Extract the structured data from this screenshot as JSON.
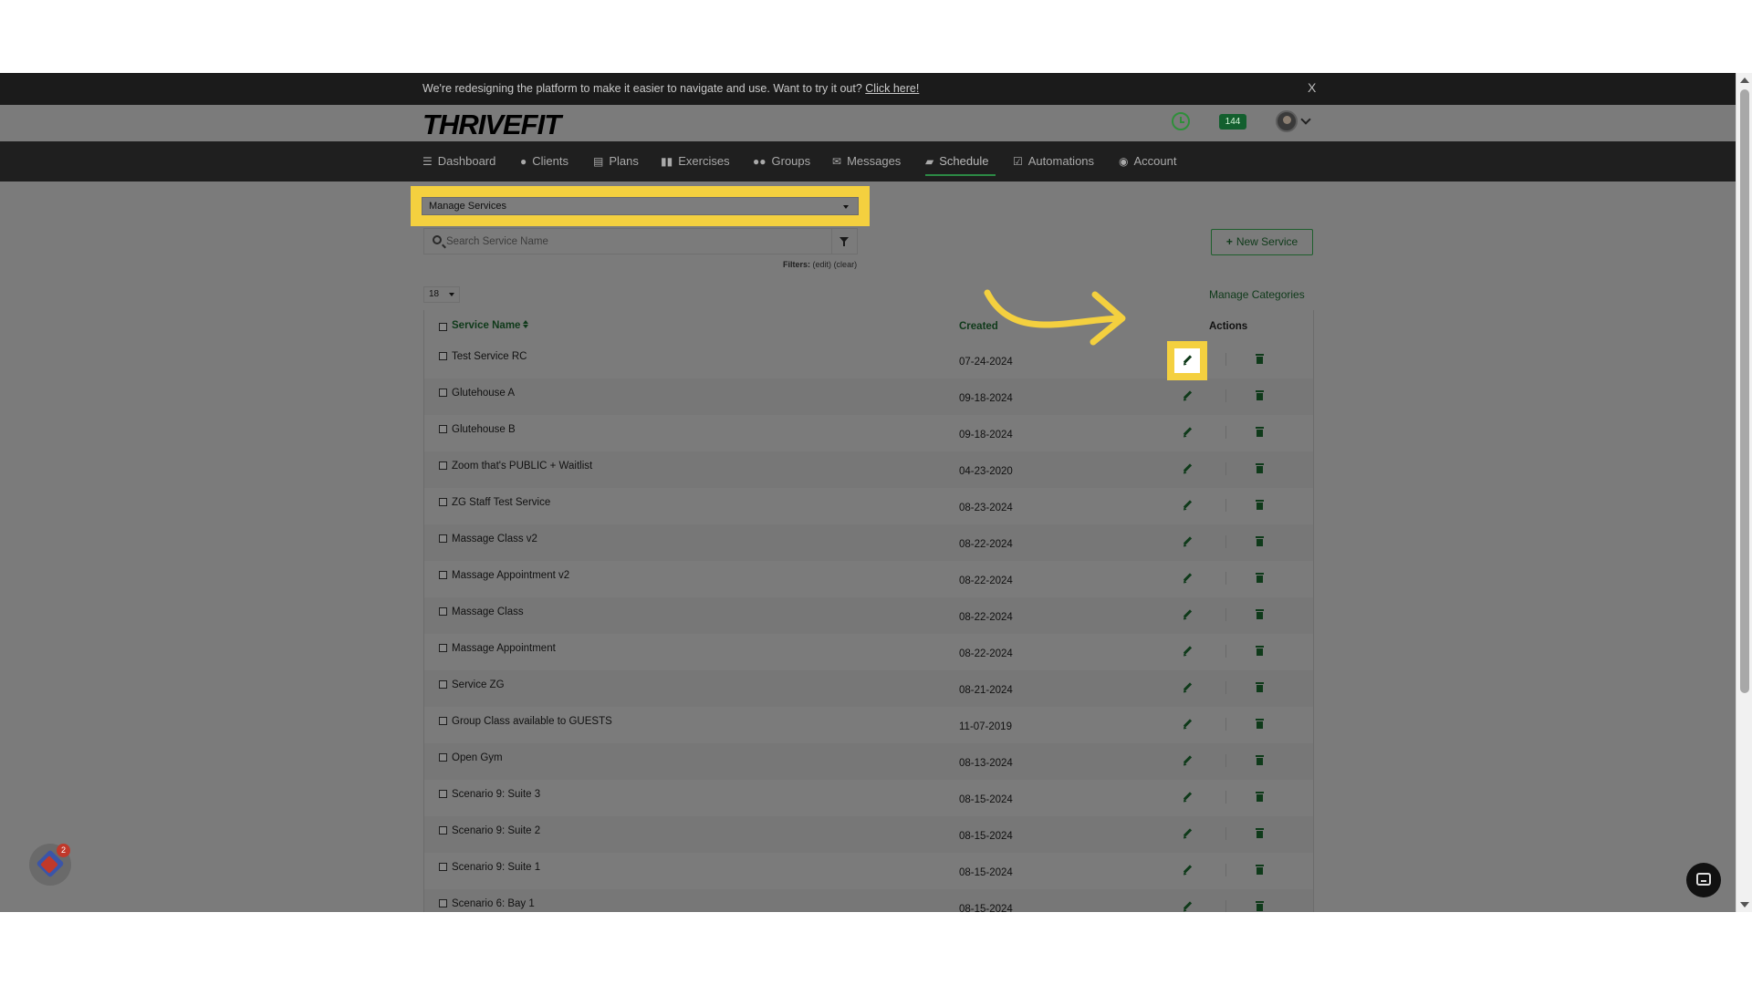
{
  "announcement": {
    "message": "We're redesigning the platform to make it easier to navigate and use. Want to try it out? ",
    "link_text": "Click here!",
    "close_label": "X"
  },
  "brand": {
    "logo": "THRIVEFIT",
    "notification_count": "144"
  },
  "nav": {
    "items": [
      {
        "label": "Dashboard",
        "icon": "list-icon"
      },
      {
        "label": "Clients",
        "icon": "user-icon"
      },
      {
        "label": "Plans",
        "icon": "clipboard-icon"
      },
      {
        "label": "Exercises",
        "icon": "dumbbell-icon"
      },
      {
        "label": "Groups",
        "icon": "users-icon"
      },
      {
        "label": "Messages",
        "icon": "envelope-icon"
      },
      {
        "label": "Schedule",
        "icon": "book-icon",
        "active": true
      },
      {
        "label": "Automations",
        "icon": "check-square-icon"
      },
      {
        "label": "Account",
        "icon": "user-circle-icon"
      }
    ]
  },
  "toolbar": {
    "view_select": "Manage Services",
    "search_placeholder": "Search Service Name",
    "filters_label": "Filters:",
    "filters_edit": "(edit)",
    "filters_clear": "(clear)",
    "new_service_label": "New Service",
    "page_size": "18",
    "manage_categories_label": "Manage Categories"
  },
  "table": {
    "columns": {
      "name": "Service Name",
      "created": "Created",
      "actions": "Actions"
    },
    "rows": [
      {
        "name": "Test Service RC",
        "created": "07-24-2024"
      },
      {
        "name": "Glutehouse A",
        "created": "09-18-2024"
      },
      {
        "name": "Glutehouse B",
        "created": "09-18-2024"
      },
      {
        "name": "Zoom that's PUBLIC + Waitlist",
        "created": "04-23-2020"
      },
      {
        "name": "ZG Staff Test Service",
        "created": "08-23-2024"
      },
      {
        "name": "Massage Class v2",
        "created": "08-22-2024"
      },
      {
        "name": "Massage Appointment v2",
        "created": "08-22-2024"
      },
      {
        "name": "Massage Class",
        "created": "08-22-2024"
      },
      {
        "name": "Massage Appointment",
        "created": "08-22-2024"
      },
      {
        "name": "Service ZG",
        "created": "08-21-2024"
      },
      {
        "name": "Group Class available to GUESTS",
        "created": "11-07-2019"
      },
      {
        "name": "Open Gym",
        "created": "08-13-2024"
      },
      {
        "name": "Scenario 9: Suite 3",
        "created": "08-15-2024"
      },
      {
        "name": "Scenario 9: Suite 2",
        "created": "08-15-2024"
      },
      {
        "name": "Scenario 9: Suite 1",
        "created": "08-15-2024"
      },
      {
        "name": "Scenario 6: Bay 1",
        "created": "08-15-2024"
      }
    ]
  },
  "widgets": {
    "left_badge": "2"
  },
  "colors": {
    "highlight": "#f4d03f",
    "accent_green": "#2c8a45",
    "nav_bg": "#1f1f1f"
  }
}
